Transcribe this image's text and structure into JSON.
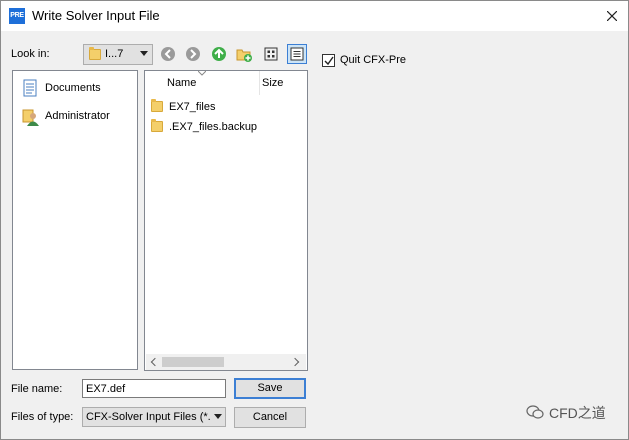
{
  "window": {
    "title": "Write Solver Input File",
    "app_icon_text": "PRE"
  },
  "toolbar": {
    "look_in_label": "Look in:",
    "look_in_value": "I...7"
  },
  "places": [
    {
      "label": "Documents",
      "icon": "documents-icon"
    },
    {
      "label": "Administrator",
      "icon": "user-icon"
    }
  ],
  "file_list": {
    "columns": [
      "Name",
      "Size"
    ],
    "rows": [
      {
        "name": "EX7_files",
        "icon": "folder-icon"
      },
      {
        "name": ".EX7_files.backup",
        "icon": "folder-icon"
      }
    ]
  },
  "options": {
    "quit_label": "Quit CFX-Pre",
    "quit_checked": true
  },
  "filename": {
    "label": "File name:",
    "value": "EX7.def"
  },
  "filetype": {
    "label": "Files of type:",
    "value": "CFX-Solver Input Files (*."
  },
  "buttons": {
    "save": "Save",
    "cancel": "Cancel"
  },
  "watermark": "CFD之道",
  "colors": {
    "accent": "#3c7fd4",
    "nav_green": "#3fae49",
    "nav_gray": "#9a9a9a",
    "folder": "#f4cf6a"
  }
}
